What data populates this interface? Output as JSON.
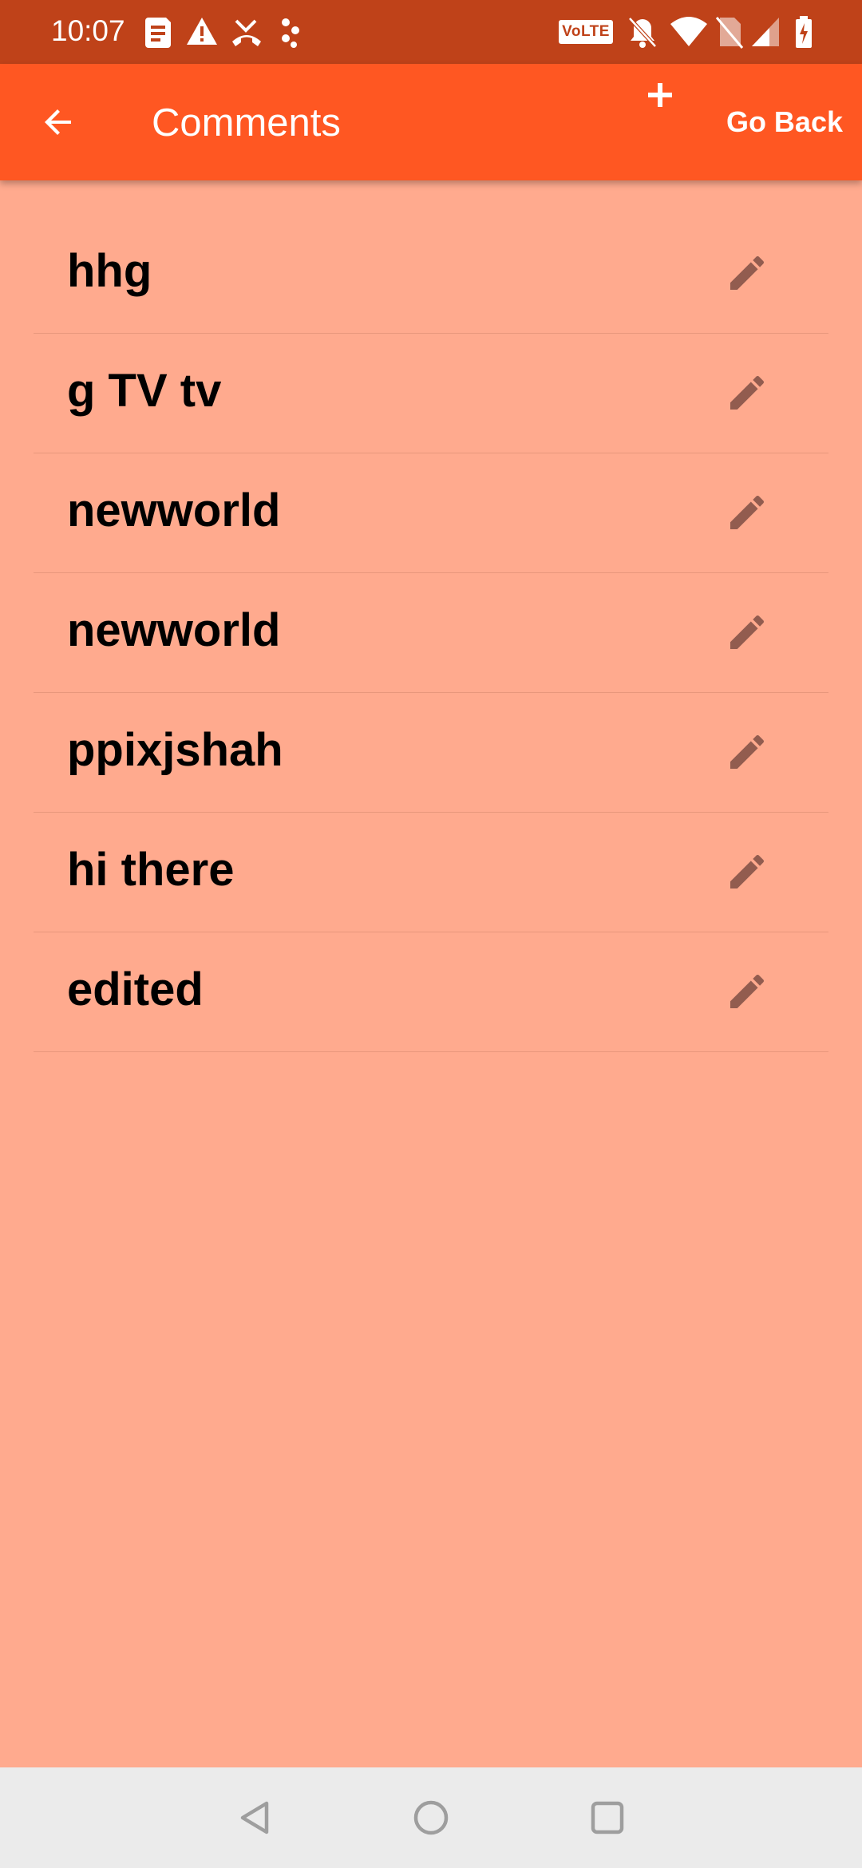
{
  "status_bar": {
    "time": "10:07",
    "network_badge": "VoLTE",
    "left_icons": [
      "sim-card-icon",
      "warning-icon",
      "missed-call-icon",
      "app-notification-icon"
    ],
    "right_icons": [
      "volte-icon",
      "notifications-off-icon",
      "wifi-icon",
      "no-sim-icon",
      "cell-signal-icon",
      "battery-charging-icon"
    ]
  },
  "app_bar": {
    "title": "Comments",
    "go_back_label": "Go Back",
    "background_color": "#FF5722"
  },
  "comments": [
    {
      "text": "hhg"
    },
    {
      "text": "g TV tv"
    },
    {
      "text": "newworld"
    },
    {
      "text": "newworld"
    },
    {
      "text": "ppixjshah"
    },
    {
      "text": "hi there"
    },
    {
      "text": "edited"
    }
  ],
  "colors": {
    "status_bar": "#BF4219",
    "content_background": "#FFAA8E",
    "edit_icon": "#925C4F",
    "nav_bar": "#EBEBEB"
  }
}
